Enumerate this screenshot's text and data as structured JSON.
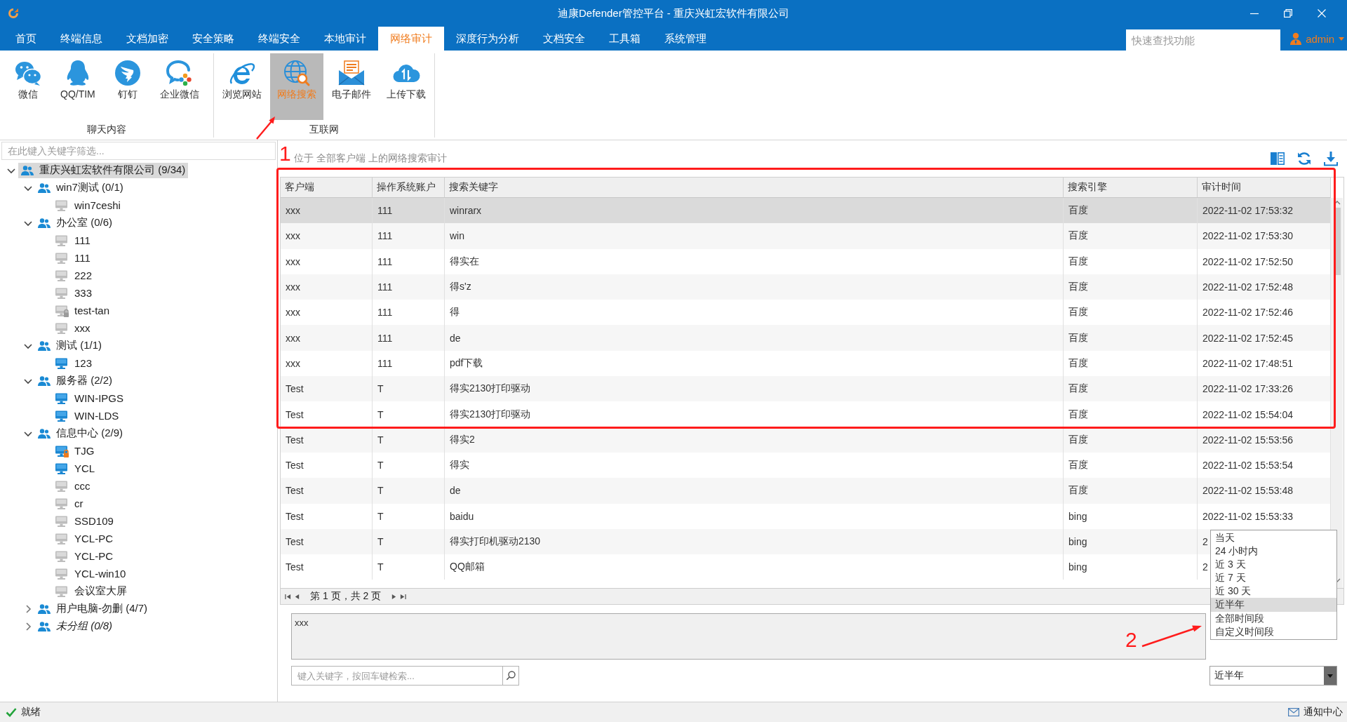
{
  "window": {
    "title": "迪康Defender管控平台 - 重庆兴虹宏软件有限公司"
  },
  "menu": {
    "tabs": [
      {
        "label": "首页",
        "selected": false
      },
      {
        "label": "终端信息",
        "selected": false
      },
      {
        "label": "文档加密",
        "selected": false
      },
      {
        "label": "安全策略",
        "selected": false
      },
      {
        "label": "终端安全",
        "selected": false
      },
      {
        "label": "本地审计",
        "selected": false
      },
      {
        "label": "网络审计",
        "selected": true
      },
      {
        "label": "深度行为分析",
        "selected": false
      },
      {
        "label": "文档安全",
        "selected": false
      },
      {
        "label": "工具箱",
        "selected": false
      },
      {
        "label": "系统管理",
        "selected": false
      }
    ],
    "search": {
      "placeholder": "快速查找功能"
    },
    "user": {
      "name": "admin"
    }
  },
  "ribbon": {
    "groups": [
      {
        "label": "聊天内容",
        "items": [
          {
            "label": "微信",
            "selected": false
          },
          {
            "label": "QQ/TIM",
            "selected": false
          },
          {
            "label": "钉钉",
            "selected": false
          },
          {
            "label": "企业微信",
            "selected": false
          }
        ]
      },
      {
        "label": "互联网",
        "items": [
          {
            "label": "浏览网站",
            "selected": false
          },
          {
            "label": "网络搜索",
            "selected": true
          },
          {
            "label": "电子邮件",
            "selected": false
          },
          {
            "label": "上传下载",
            "selected": false
          }
        ]
      }
    ]
  },
  "sidebar": {
    "filter": {
      "placeholder": "在此键入关键字筛选..."
    },
    "tree": [
      {
        "label": "重庆兴虹宏软件有限公司 (9/34)",
        "kind": "group",
        "expanded": true,
        "selected": true,
        "children": [
          {
            "label": "win7测试 (0/1)",
            "kind": "group",
            "expanded": true,
            "selected": false,
            "children": [
              {
                "label": "win7ceshi",
                "kind": "computer",
                "online": false,
                "locked": false,
                "selected": false
              }
            ]
          },
          {
            "label": "办公室 (0/6)",
            "kind": "group",
            "expanded": true,
            "selected": false,
            "children": [
              {
                "label": "111",
                "kind": "computer",
                "online": false,
                "locked": false,
                "selected": false
              },
              {
                "label": "111",
                "kind": "computer",
                "online": false,
                "locked": false,
                "selected": false
              },
              {
                "label": "222",
                "kind": "computer",
                "online": false,
                "locked": false,
                "selected": false
              },
              {
                "label": "333",
                "kind": "computer",
                "online": false,
                "locked": false,
                "selected": false
              },
              {
                "label": "test-tan",
                "kind": "computer",
                "online": false,
                "locked": true,
                "selected": false
              },
              {
                "label": "xxx",
                "kind": "computer",
                "online": false,
                "locked": false,
                "selected": false
              }
            ]
          },
          {
            "label": "测试 (1/1)",
            "kind": "group",
            "expanded": true,
            "selected": false,
            "children": [
              {
                "label": "123",
                "kind": "computer",
                "online": true,
                "locked": false,
                "selected": false
              }
            ]
          },
          {
            "label": "服务器 (2/2)",
            "kind": "group",
            "expanded": true,
            "selected": false,
            "children": [
              {
                "label": "WIN-IPGS",
                "kind": "computer",
                "online": true,
                "locked": false,
                "selected": false
              },
              {
                "label": "WIN-LDS",
                "kind": "computer",
                "online": true,
                "locked": false,
                "selected": false
              }
            ]
          },
          {
            "label": "信息中心 (2/9)",
            "kind": "group",
            "expanded": true,
            "selected": false,
            "children": [
              {
                "label": "TJG",
                "kind": "computer",
                "online": true,
                "locked": true,
                "selected": false
              },
              {
                "label": "YCL",
                "kind": "computer",
                "online": true,
                "locked": false,
                "selected": false
              },
              {
                "label": "ccc",
                "kind": "computer",
                "online": false,
                "locked": false,
                "selected": false
              },
              {
                "label": "cr",
                "kind": "computer",
                "online": false,
                "locked": false,
                "selected": false
              },
              {
                "label": "SSD109",
                "kind": "computer",
                "online": false,
                "locked": false,
                "selected": false
              },
              {
                "label": "YCL-PC",
                "kind": "computer",
                "online": false,
                "locked": false,
                "selected": false
              },
              {
                "label": "YCL-PC",
                "kind": "computer",
                "online": false,
                "locked": false,
                "selected": false
              },
              {
                "label": "YCL-win10",
                "kind": "computer",
                "online": false,
                "locked": false,
                "selected": false
              },
              {
                "label": "会议室大屏",
                "kind": "computer",
                "online": false,
                "locked": false,
                "selected": false
              }
            ]
          },
          {
            "label": "用户电脑-勿删 (4/7)",
            "kind": "group",
            "expanded": false,
            "selected": false
          },
          {
            "label": "未分组 (0/8)",
            "kind": "ungrouped",
            "expanded": false,
            "selected": false
          }
        ]
      }
    ]
  },
  "content": {
    "caption": "位于 全部客户端 上的网络搜索审计",
    "table": {
      "columns": [
        "客户端",
        "操作系统账户",
        "搜索关键字",
        "搜索引擎",
        "审计时间"
      ],
      "rows": [
        {
          "cells": [
            "xxx",
            "111",
            "winrarx",
            "百度",
            "2022-11-02 17:53:32"
          ],
          "selected": true
        },
        {
          "cells": [
            "xxx",
            "111",
            "win",
            "百度",
            "2022-11-02 17:53:30"
          ],
          "selected": false
        },
        {
          "cells": [
            "xxx",
            "111",
            "得实在",
            "百度",
            "2022-11-02 17:52:50"
          ],
          "selected": false
        },
        {
          "cells": [
            "xxx",
            "111",
            "得s'z",
            "百度",
            "2022-11-02 17:52:48"
          ],
          "selected": false
        },
        {
          "cells": [
            "xxx",
            "111",
            "得",
            "百度",
            "2022-11-02 17:52:46"
          ],
          "selected": false
        },
        {
          "cells": [
            "xxx",
            "111",
            "de",
            "百度",
            "2022-11-02 17:52:45"
          ],
          "selected": false
        },
        {
          "cells": [
            "xxx",
            "111",
            "pdf下载",
            "百度",
            "2022-11-02 17:48:51"
          ],
          "selected": false
        },
        {
          "cells": [
            "Test",
            "T",
            "得实2130打印驱动",
            "百度",
            "2022-11-02 17:33:26"
          ],
          "selected": false
        },
        {
          "cells": [
            "Test",
            "T",
            "得实2130打印驱动",
            "百度",
            "2022-11-02 15:54:04"
          ],
          "selected": false
        },
        {
          "cells": [
            "Test",
            "T",
            "得实2",
            "百度",
            "2022-11-02 15:53:56"
          ],
          "selected": false
        },
        {
          "cells": [
            "Test",
            "T",
            "得实",
            "百度",
            "2022-11-02 15:53:54"
          ],
          "selected": false
        },
        {
          "cells": [
            "Test",
            "T",
            "de",
            "百度",
            "2022-11-02 15:53:48"
          ],
          "selected": false
        },
        {
          "cells": [
            "Test",
            "T",
            "baidu",
            "bing",
            "2022-11-02 15:53:33"
          ],
          "selected": false
        },
        {
          "cells": [
            "Test",
            "T",
            "得实打印机驱动2130",
            "bing",
            "2"
          ],
          "selected": false
        },
        {
          "cells": [
            "Test",
            "T",
            "QQ邮箱",
            "bing",
            "2"
          ],
          "selected": false
        }
      ]
    },
    "pager": {
      "text": "第 1 页，共 2 页"
    },
    "detail": {
      "value": "xxx"
    },
    "search": {
      "placeholder": "键入关键字，按回车键检索..."
    },
    "time_range": {
      "value": "近半年",
      "expanded": true,
      "options": [
        {
          "label": "当天",
          "selected": false
        },
        {
          "label": "24 小时内",
          "selected": false
        },
        {
          "label": "近 3 天",
          "selected": false
        },
        {
          "label": "近 7 天",
          "selected": false
        },
        {
          "label": "近 30 天",
          "selected": false
        },
        {
          "label": "近半年",
          "selected": true
        },
        {
          "label": "全部时间段",
          "selected": false
        },
        {
          "label": "自定义时间段",
          "selected": false
        }
      ]
    }
  },
  "status_bar": {
    "text": "就绪",
    "notifications": "通知中心"
  },
  "annotations": [
    {
      "kind": "arrow"
    },
    {
      "kind": "box",
      "label": "1"
    },
    {
      "kind": "arrow",
      "label": "2"
    }
  ]
}
